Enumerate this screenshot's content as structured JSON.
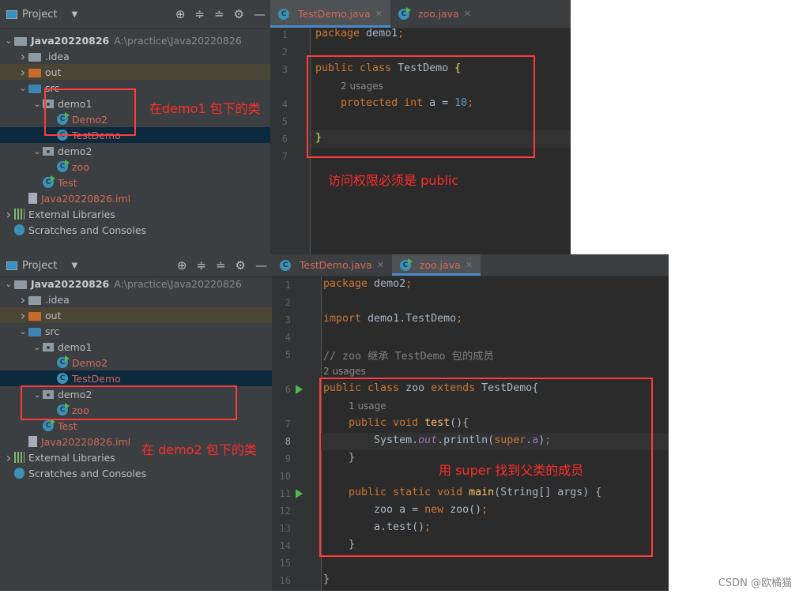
{
  "top": {
    "panel_title": "Project",
    "tree": [
      {
        "label": "Java20220826",
        "extra": "A:\\practice\\Java20220826",
        "level": 0,
        "arrow": "down",
        "icon": "module",
        "style": "bold"
      },
      {
        "label": ".idea",
        "level": 1,
        "arrow": "right",
        "icon": "folder"
      },
      {
        "label": "out",
        "level": 1,
        "arrow": "right",
        "icon": "folder-orange",
        "row": "hl"
      },
      {
        "label": "src",
        "level": 1,
        "arrow": "down",
        "icon": "folder-blue"
      },
      {
        "label": "demo1",
        "level": 2,
        "arrow": "down",
        "icon": "package"
      },
      {
        "label": "Demo2",
        "level": 3,
        "icon": "class-run",
        "style": "red"
      },
      {
        "label": "TestDemo",
        "level": 3,
        "icon": "class",
        "style": "red",
        "row": "sel"
      },
      {
        "label": "demo2",
        "level": 2,
        "arrow": "down",
        "icon": "package"
      },
      {
        "label": "zoo",
        "level": 3,
        "icon": "class-run",
        "style": "red"
      },
      {
        "label": "Test",
        "level": 2,
        "icon": "class-run",
        "style": "red"
      },
      {
        "label": "Java20220826.iml",
        "level": 1,
        "icon": "file",
        "style": "red"
      },
      {
        "label": "External Libraries",
        "level": 0,
        "arrow": "right",
        "icon": "libraries"
      },
      {
        "label": "Scratches and Consoles",
        "level": 0,
        "icon": "scratches"
      }
    ],
    "tabs": [
      {
        "label": "TestDemo.java",
        "active": true
      },
      {
        "label": "zoo.java",
        "active": false
      }
    ],
    "lines": [
      {
        "n": "1",
        "tokens": [
          [
            "package",
            "kw"
          ],
          [
            " demo1",
            ""
          ],
          [
            ";",
            "kw"
          ]
        ]
      },
      {
        "n": "2",
        "tokens": []
      },
      {
        "n": "3",
        "tokens": [
          [
            "public class",
            "kw"
          ],
          [
            " TestDemo ",
            ""
          ],
          [
            "{",
            "brace"
          ]
        ]
      },
      {
        "hint": "2 usages"
      },
      {
        "n": "4",
        "tokens": [
          [
            "    protected int",
            "kw"
          ],
          [
            " a",
            ""
          ],
          [
            " = ",
            ""
          ],
          [
            "10",
            "num"
          ],
          [
            ";",
            "kw"
          ]
        ]
      },
      {
        "n": "5",
        "tokens": []
      },
      {
        "n": "6",
        "tokens": [
          [
            "}",
            "brace"
          ]
        ]
      },
      {
        "n": "7",
        "tokens": []
      }
    ],
    "annotation": "访问权限必须是 public",
    "tree_annotation": "在demo1 包下的类"
  },
  "bottom": {
    "panel_title": "Project",
    "tree": [
      {
        "label": "Java20220826",
        "extra": "A:\\practice\\Java20220826",
        "level": 0,
        "arrow": "down",
        "icon": "module",
        "style": "bold"
      },
      {
        "label": ".idea",
        "level": 1,
        "arrow": "right",
        "icon": "folder"
      },
      {
        "label": "out",
        "level": 1,
        "arrow": "right",
        "icon": "folder-orange",
        "row": "hl"
      },
      {
        "label": "src",
        "level": 1,
        "arrow": "down",
        "icon": "folder-blue"
      },
      {
        "label": "demo1",
        "level": 2,
        "arrow": "down",
        "icon": "package"
      },
      {
        "label": "Demo2",
        "level": 3,
        "icon": "class-run",
        "style": "red"
      },
      {
        "label": "TestDemo",
        "level": 3,
        "icon": "class",
        "style": "red",
        "row": "sel"
      },
      {
        "label": "demo2",
        "level": 2,
        "arrow": "down",
        "icon": "package"
      },
      {
        "label": "zoo",
        "level": 3,
        "icon": "class-run",
        "style": "red"
      },
      {
        "label": "Test",
        "level": 2,
        "icon": "class-run",
        "style": "red"
      },
      {
        "label": "Java20220826.iml",
        "level": 1,
        "icon": "file",
        "style": "red"
      },
      {
        "label": "External Libraries",
        "level": 0,
        "arrow": "right",
        "icon": "libraries"
      },
      {
        "label": "Scratches and Consoles",
        "level": 0,
        "icon": "scratches"
      }
    ],
    "tabs": [
      {
        "label": "TestDemo.java",
        "active": false
      },
      {
        "label": "zoo.java",
        "active": true
      }
    ],
    "lines": [
      {
        "n": "1",
        "tokens": [
          [
            "package",
            "kw"
          ],
          [
            " demo2",
            ""
          ],
          [
            ";",
            "kw"
          ]
        ]
      },
      {
        "n": "2",
        "tokens": []
      },
      {
        "n": "3",
        "tokens": [
          [
            "import",
            "kw"
          ],
          [
            " demo1.TestDemo",
            ""
          ],
          [
            ";",
            "kw"
          ]
        ]
      },
      {
        "n": "4",
        "tokens": []
      },
      {
        "n": "5",
        "tokens": [
          [
            "// zoo 继承 TestDemo 包的成员",
            "cm"
          ]
        ]
      },
      {
        "hint": "2 usages"
      },
      {
        "n": "6",
        "run": true,
        "tokens": [
          [
            "public class",
            "kw"
          ],
          [
            " zoo ",
            ""
          ],
          [
            "extends",
            "kw"
          ],
          [
            " TestDemo{",
            ""
          ]
        ]
      },
      {
        "hint": "1 usage",
        "indent": 1
      },
      {
        "n": "7",
        "tokens": [
          [
            "    public void",
            "kw"
          ],
          [
            " ",
            ""
          ],
          [
            "test",
            "fn"
          ],
          [
            "(){",
            ""
          ]
        ]
      },
      {
        "n": "8",
        "current": true,
        "tokens": [
          [
            "        System.",
            ""
          ],
          [
            "out",
            "it"
          ],
          [
            ".println(",
            ""
          ],
          [
            "super",
            "kw"
          ],
          [
            ".",
            ""
          ],
          [
            "a",
            "fld"
          ],
          [
            ")",
            ""
          ],
          [
            ";",
            "kw"
          ]
        ]
      },
      {
        "n": "9",
        "tokens": [
          [
            "    }",
            ""
          ]
        ]
      },
      {
        "n": "10",
        "tokens": []
      },
      {
        "n": "11",
        "run": true,
        "tokens": [
          [
            "    public static void",
            "kw"
          ],
          [
            " ",
            ""
          ],
          [
            "main",
            "fn"
          ],
          [
            "(String[] args) {",
            ""
          ]
        ]
      },
      {
        "n": "12",
        "tokens": [
          [
            "        zoo a = ",
            ""
          ],
          [
            "new",
            "kw"
          ],
          [
            " zoo()",
            ""
          ],
          [
            ";",
            "kw"
          ]
        ]
      },
      {
        "n": "13",
        "tokens": [
          [
            "        a.test()",
            ""
          ],
          [
            ";",
            "kw"
          ]
        ]
      },
      {
        "n": "14",
        "tokens": [
          [
            "    }",
            ""
          ]
        ]
      },
      {
        "n": "15",
        "tokens": []
      },
      {
        "n": "16",
        "tokens": [
          [
            "}",
            ""
          ]
        ]
      }
    ],
    "annotation": "用 super 找到父类的成员",
    "tree_annotation": "在 demo2 包下的类"
  },
  "watermark": "CSDN @欧橘猫",
  "colors": {
    "keyword": "#cc7832",
    "annotation": "#ff2d2d",
    "selection": "#0d293e"
  }
}
